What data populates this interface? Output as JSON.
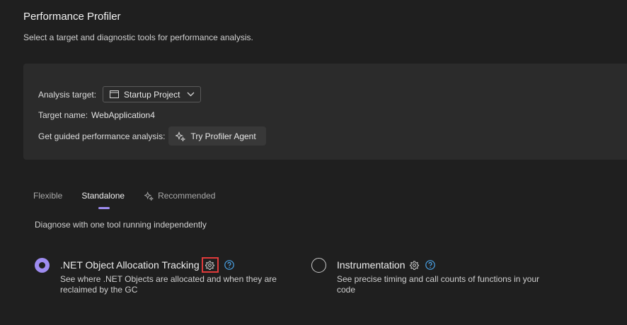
{
  "header": {
    "title": "Performance Profiler",
    "subtitle": "Select a target and diagnostic tools for performance analysis."
  },
  "target": {
    "analysis_label": "Analysis target:",
    "analysis_value": "Startup Project",
    "name_label": "Target name:",
    "name_value": "WebApplication4",
    "guided_label": "Get guided performance analysis:",
    "agent_button": "Try Profiler Agent"
  },
  "tabs": [
    {
      "label": "Flexible",
      "active": false
    },
    {
      "label": "Standalone",
      "active": true
    },
    {
      "label": "Recommended",
      "active": false
    }
  ],
  "tab_description": "Diagnose with one tool running independently",
  "tools": [
    {
      "title": ".NET Object Allocation Tracking",
      "description": "See where .NET Objects are allocated and when they are reclaimed by the GC",
      "selected": true
    },
    {
      "title": "Instrumentation",
      "description": "See precise timing and call counts of functions in your code",
      "selected": false
    }
  ],
  "colors": {
    "accent": "#9e8cf0",
    "highlight": "#e03b3b",
    "background": "#1f1f1f",
    "panel": "#2b2b2b",
    "help": "#4aa3e8"
  },
  "icons": [
    "window-icon",
    "chevron-down-icon",
    "sparkle-icon",
    "gear-icon",
    "help-icon"
  ]
}
